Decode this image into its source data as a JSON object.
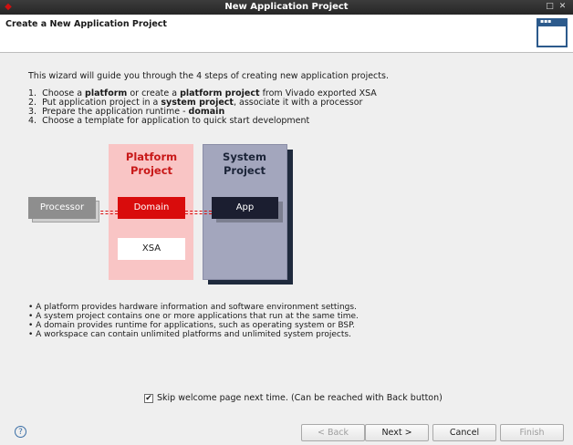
{
  "window": {
    "title": "New Application Project"
  },
  "header": {
    "title": "Create a New Application Project"
  },
  "intro": "This wizard will guide you through the 4 steps of creating new application projects.",
  "steps": [
    {
      "n": "1.",
      "parts": [
        [
          "Choose a ",
          false
        ],
        [
          "platform",
          true
        ],
        [
          " or create a ",
          false
        ],
        [
          "platform project",
          true
        ],
        [
          " from Vivado exported XSA",
          false
        ]
      ]
    },
    {
      "n": "2.",
      "parts": [
        [
          "Put application project in a ",
          false
        ],
        [
          "system project",
          true
        ],
        [
          ", associate it with a processor",
          false
        ]
      ]
    },
    {
      "n": "3.",
      "parts": [
        [
          "Prepare the application runtime - ",
          false
        ],
        [
          "domain",
          true
        ]
      ]
    },
    {
      "n": "4.",
      "parts": [
        [
          "Choose a template for application to quick start development",
          false
        ]
      ]
    }
  ],
  "diagram": {
    "platform_title": "Platform Project",
    "system_title": "System Project",
    "processor": "Processor",
    "domain": "Domain",
    "app": "App",
    "xsa": "XSA"
  },
  "bullets": [
    "• A platform provides hardware information and software environment settings.",
    "• A system project contains one or more applications that run at the same time.",
    "• A domain provides runtime for applications, such as operating system or BSP.",
    "• A workspace can contain unlimited platforms and unlimited system projects."
  ],
  "skip": {
    "label": "Skip welcome page next time. (Can be reached with Back button)",
    "checked": true
  },
  "buttons": {
    "back": "< Back",
    "next": "Next >",
    "cancel": "Cancel",
    "finish": "Finish"
  },
  "colors": {
    "platform_fill": "#f9c5c5",
    "platform_text": "#c81818",
    "domain": "#d90c0c",
    "system_fill": "#a3a6bd",
    "app": "#1b1e30"
  }
}
